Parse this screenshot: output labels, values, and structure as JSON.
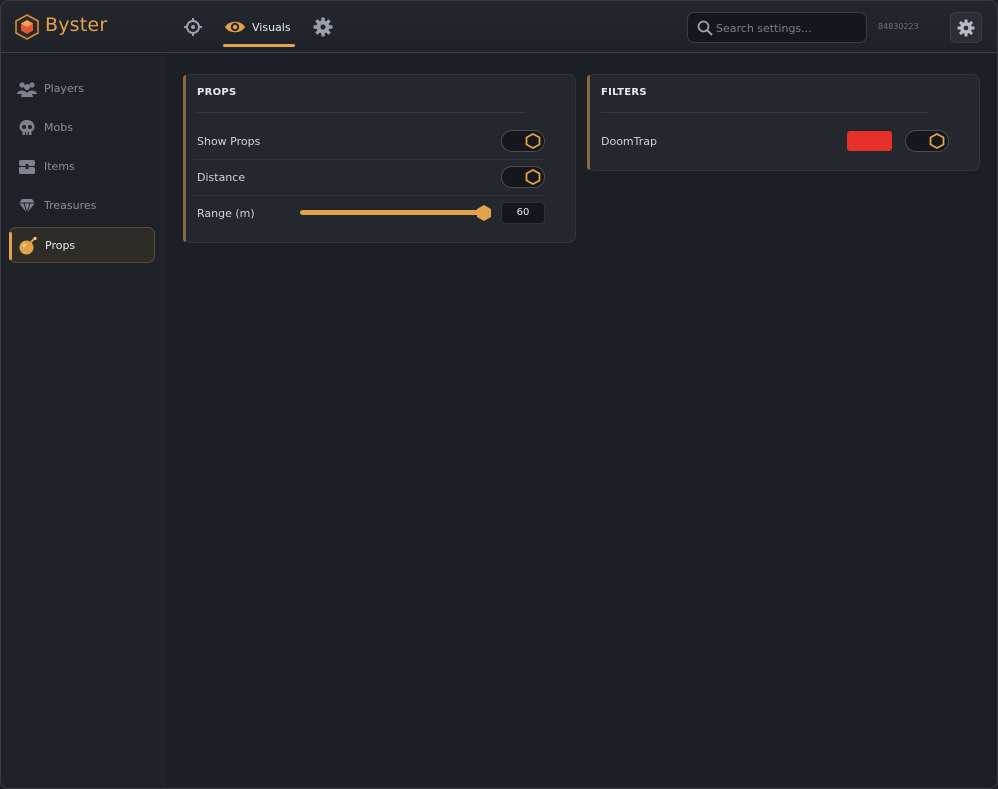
{
  "app": {
    "brand": "Byster",
    "user_id": "84830223"
  },
  "header": {
    "active_tab_label": "Visuals",
    "search_placeholder": "Search settings..."
  },
  "colors": {
    "accent": "#e3a348",
    "swatch": "#e8302a"
  },
  "sidebar": {
    "items": [
      {
        "label": "Players",
        "icon": "players-icon"
      },
      {
        "label": "Mobs",
        "icon": "skull-icon"
      },
      {
        "label": "Items",
        "icon": "chest-icon"
      },
      {
        "label": "Treasures",
        "icon": "gem-icon"
      },
      {
        "label": "Props",
        "icon": "bomb-icon",
        "active": true
      }
    ]
  },
  "props_panel": {
    "title": "PROPS",
    "show_props_label": "Show Props",
    "show_props_on": true,
    "distance_label": "Distance",
    "distance_on": true,
    "range_label": "Range (m)",
    "range_value": "60",
    "range_fraction": 1.0
  },
  "filters_panel": {
    "title": "FILTERS",
    "doomtrap_label": "DoomTrap",
    "doomtrap_on": true
  }
}
